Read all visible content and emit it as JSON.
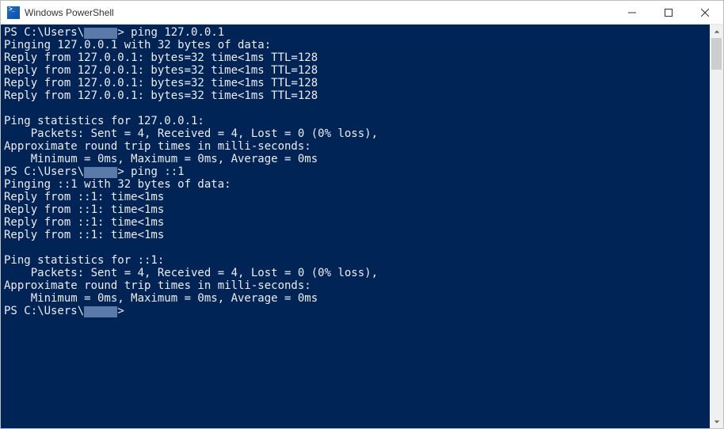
{
  "window": {
    "title": "Windows PowerShell"
  },
  "terminal": {
    "prompt_prefix": "PS C:\\Users\\",
    "prompt_suffix": "> ",
    "redacted_placeholder": "█████",
    "lines": [
      {
        "t": "prompt",
        "cmd": "ping 127.0.0.1"
      },
      {
        "t": "out",
        "text": "Pinging 127.0.0.1 with 32 bytes of data:"
      },
      {
        "t": "out",
        "text": "Reply from 127.0.0.1: bytes=32 time<1ms TTL=128"
      },
      {
        "t": "out",
        "text": "Reply from 127.0.0.1: bytes=32 time<1ms TTL=128"
      },
      {
        "t": "out",
        "text": "Reply from 127.0.0.1: bytes=32 time<1ms TTL=128"
      },
      {
        "t": "out",
        "text": "Reply from 127.0.0.1: bytes=32 time<1ms TTL=128"
      },
      {
        "t": "out",
        "text": ""
      },
      {
        "t": "out",
        "text": "Ping statistics for 127.0.0.1:"
      },
      {
        "t": "out",
        "text": "    Packets: Sent = 4, Received = 4, Lost = 0 (0% loss),"
      },
      {
        "t": "out",
        "text": "Approximate round trip times in milli-seconds:"
      },
      {
        "t": "out",
        "text": "    Minimum = 0ms, Maximum = 0ms, Average = 0ms"
      },
      {
        "t": "prompt",
        "cmd": "ping ::1"
      },
      {
        "t": "out",
        "text": "Pinging ::1 with 32 bytes of data:"
      },
      {
        "t": "out",
        "text": "Reply from ::1: time<1ms"
      },
      {
        "t": "out",
        "text": "Reply from ::1: time<1ms"
      },
      {
        "t": "out",
        "text": "Reply from ::1: time<1ms"
      },
      {
        "t": "out",
        "text": "Reply from ::1: time<1ms"
      },
      {
        "t": "out",
        "text": ""
      },
      {
        "t": "out",
        "text": "Ping statistics for ::1:"
      },
      {
        "t": "out",
        "text": "    Packets: Sent = 4, Received = 4, Lost = 0 (0% loss),"
      },
      {
        "t": "out",
        "text": "Approximate round trip times in milli-seconds:"
      },
      {
        "t": "out",
        "text": "    Minimum = 0ms, Maximum = 0ms, Average = 0ms"
      },
      {
        "t": "prompt",
        "cmd": ""
      }
    ]
  }
}
